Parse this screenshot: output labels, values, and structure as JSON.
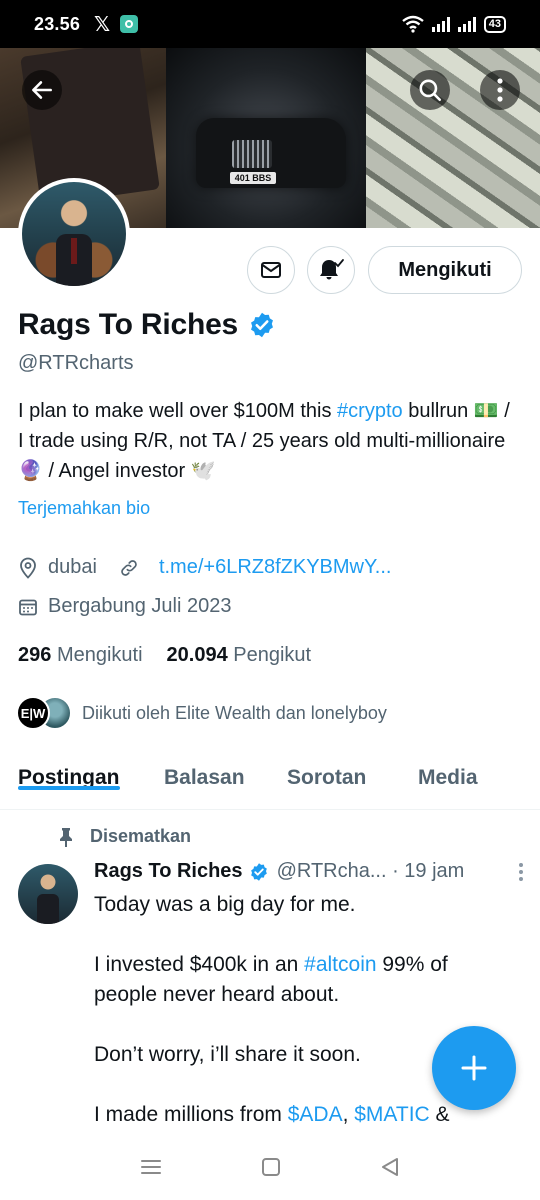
{
  "status_bar": {
    "time": "23.56",
    "x_logo": "𝕏",
    "battery": "43"
  },
  "banner": {
    "plate": "401 BBS"
  },
  "profile": {
    "name": "Rags To Riches",
    "handle": "@RTRcharts",
    "bio_line1_pre": "I plan to make well over $100M this ",
    "bio_hashtag": "#crypto",
    "bio_line2": " bullrun 💵 / I trade using R/R, not TA / 25 years old multi-millionaire 🔮 / Angel investor 🕊️",
    "translate_label": "Terjemahkan bio",
    "location": "dubai",
    "link": "t.me/+6LRZ8fZKYBMwY...",
    "joined": "Bergabung Juli 2023",
    "following_count": "296",
    "following_label": "Mengikuti",
    "followers_count": "20.094",
    "followers_label": "Pengikut",
    "followed_by": "Diikuti oleh Elite Wealth dan lonelyboy",
    "ew_avatar_text": "E|W"
  },
  "actions": {
    "follow_label": "Mengikuti"
  },
  "tabs": [
    {
      "label": "Postingan"
    },
    {
      "label": "Balasan"
    },
    {
      "label": "Sorotan"
    },
    {
      "label": "Media"
    }
  ],
  "tweet": {
    "pinned_label": "Disematkan",
    "author": "Rags To Riches",
    "handle_time": "@RTRcha... · 19 jam",
    "p1": "Today was a big day for me.",
    "p2_pre": "I invested $400k in an ",
    "p2_tag": "#altcoin",
    "p2_post": " 99% of people never heard about.",
    "p3": "Don’t worry, i’ll share it soon.",
    "p4_pre": "I made millions from ",
    "p4_tag1": "$ADA",
    "p4_sep": ", ",
    "p4_tag2": "$MATIC",
    "p4_post": " &"
  },
  "colors": {
    "accent": "#1d9bf0",
    "text": "#0f1419",
    "secondary": "#536471",
    "border": "#cfd9de"
  }
}
